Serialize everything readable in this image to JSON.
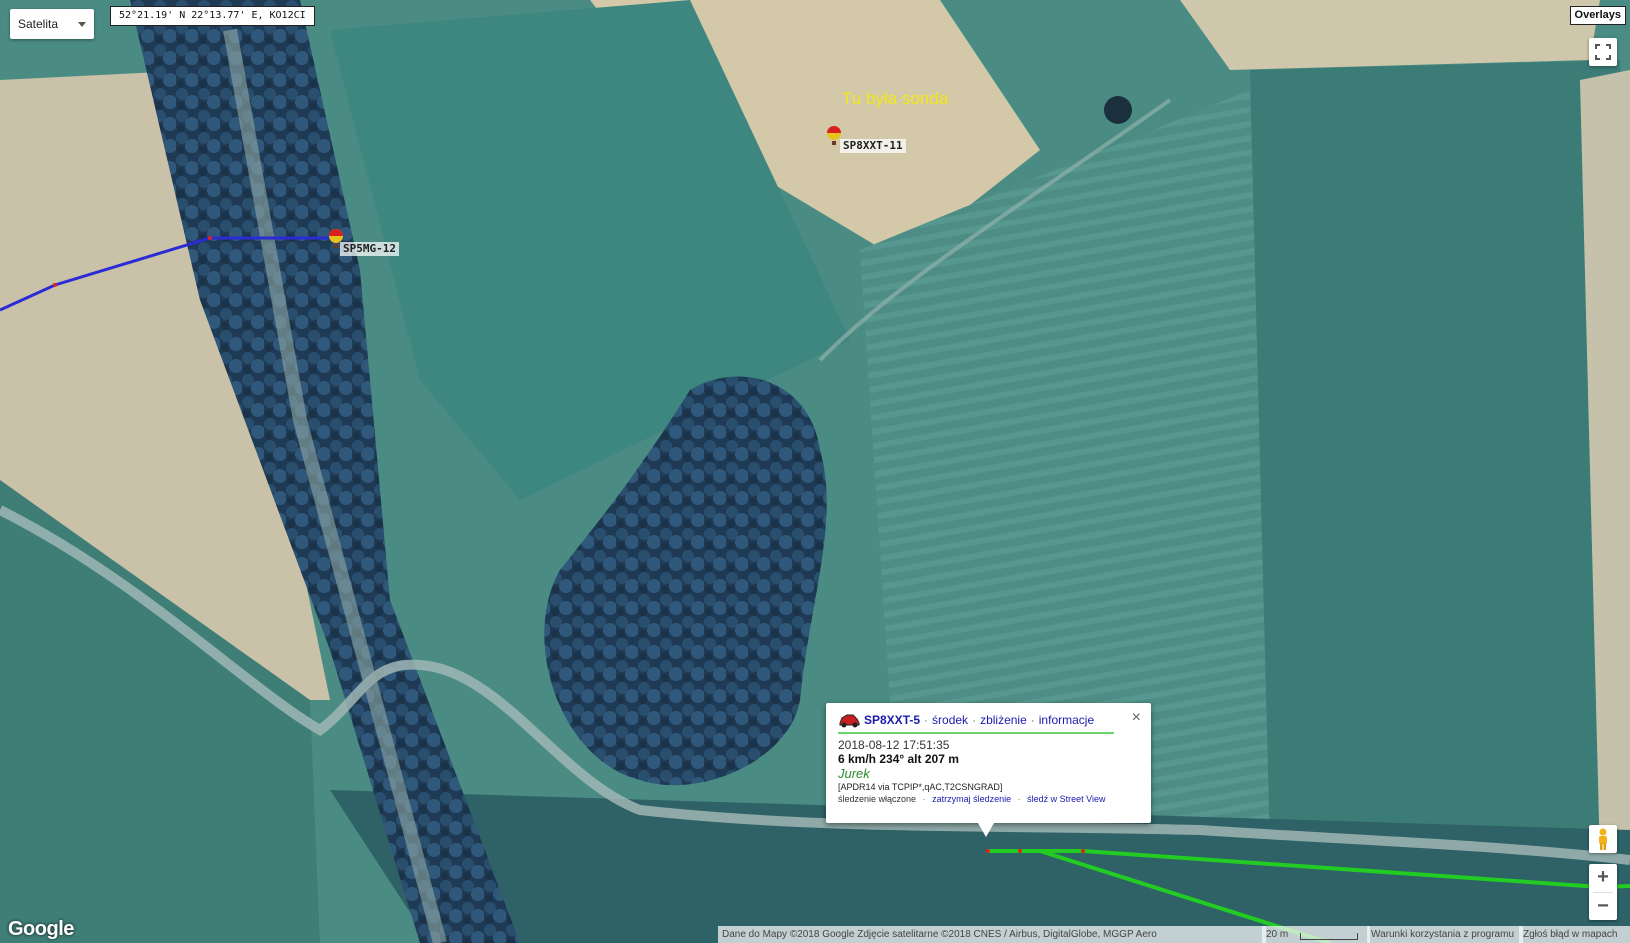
{
  "map": {
    "type_select": "Satelita",
    "coordinates": "52°21.19' N 22°13.77' E, KO12CI",
    "overlays_label": "Overlays",
    "watermark": "© 2018 Google",
    "logo": "Google"
  },
  "annotations": {
    "note": "Tu była sonda"
  },
  "stations": [
    {
      "callsign": "SP8XXT-11",
      "icon": "balloon-icon"
    },
    {
      "callsign": "SP5MG-12",
      "icon": "balloon-icon"
    }
  ],
  "popup": {
    "icon": "car-icon",
    "callsign": "SP8XXT-5",
    "links": [
      "środek",
      "zbliżenie",
      "informacje"
    ],
    "timestamp": "2018-08-12 17:51:35",
    "motion": "6 km/h 234° alt 207 m",
    "name": "Jurek",
    "path": "[APDR14 via TCPIP*,qAC,T2CSNGRAD]",
    "tracking_status": "śledzenie włączone",
    "tracking_links": [
      "zatrzymaj śledzenie",
      "śledź w Street View"
    ],
    "close": "×"
  },
  "footer": {
    "map_data": "Dane do Mapy ©2018 Google Zdjęcie satelitarne ©2018 CNES / Airbus, DigitalGlobe, MGGP Aero",
    "scale": "20 m",
    "terms": "Warunki korzystania z programu",
    "report": "Zgłoś błąd w mapach"
  },
  "colors": {
    "track_blue": "#2b2bd6",
    "track_green": "#22cc22",
    "note_yellow": "#f2e81a"
  }
}
